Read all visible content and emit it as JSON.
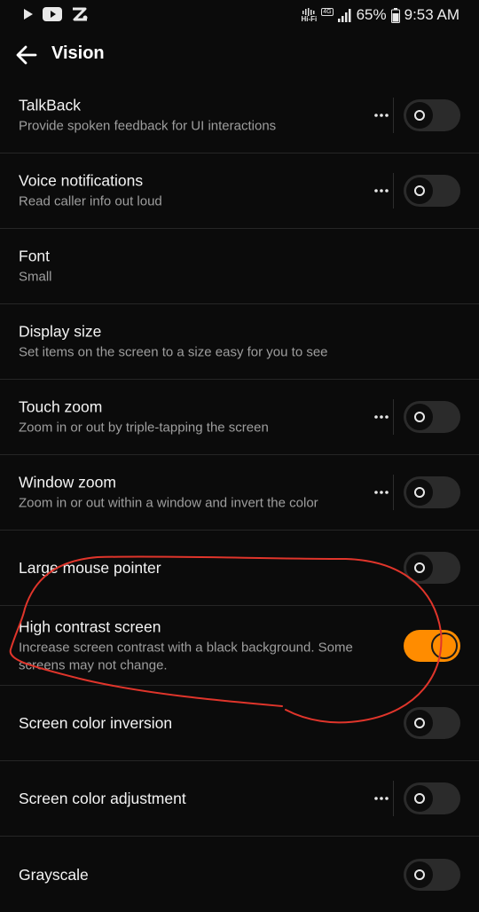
{
  "status_bar": {
    "hifi_label": "Hi-Fi",
    "network_label": "4G",
    "battery": "65%",
    "time": "9:53 AM"
  },
  "header": {
    "title": "Vision"
  },
  "settings": [
    {
      "title": "TalkBack",
      "subtitle": "Provide spoken feedback for UI interactions",
      "has_more": true,
      "toggle": "off"
    },
    {
      "title": "Voice notifications",
      "subtitle": "Read caller info out loud",
      "has_more": true,
      "toggle": "off"
    },
    {
      "title": "Font",
      "subtitle": "Small"
    },
    {
      "title": "Display size",
      "subtitle": "Set items on the screen to a size easy for you to see"
    },
    {
      "title": "Touch zoom",
      "subtitle": "Zoom in or out by triple-tapping the screen",
      "has_more": true,
      "toggle": "off"
    },
    {
      "title": "Window zoom",
      "subtitle": "Zoom in or out within a window and invert the color",
      "has_more": true,
      "toggle": "off"
    },
    {
      "title": "Large mouse pointer",
      "toggle": "off"
    },
    {
      "title": "High contrast screen",
      "subtitle": "Increase screen contrast with a black background. Some screens may not change.",
      "toggle": "on"
    },
    {
      "title": "Screen color inversion",
      "toggle": "off"
    },
    {
      "title": "Screen color adjustment",
      "has_more": true,
      "toggle": "off"
    },
    {
      "title": "Grayscale",
      "toggle": "off"
    }
  ],
  "colors": {
    "background": "#0b0b0b",
    "accent": "#ff8c00",
    "annotation": "#e0352b"
  },
  "icons": {
    "back": "back-arrow-icon",
    "more": "more-horizontal-icon"
  }
}
